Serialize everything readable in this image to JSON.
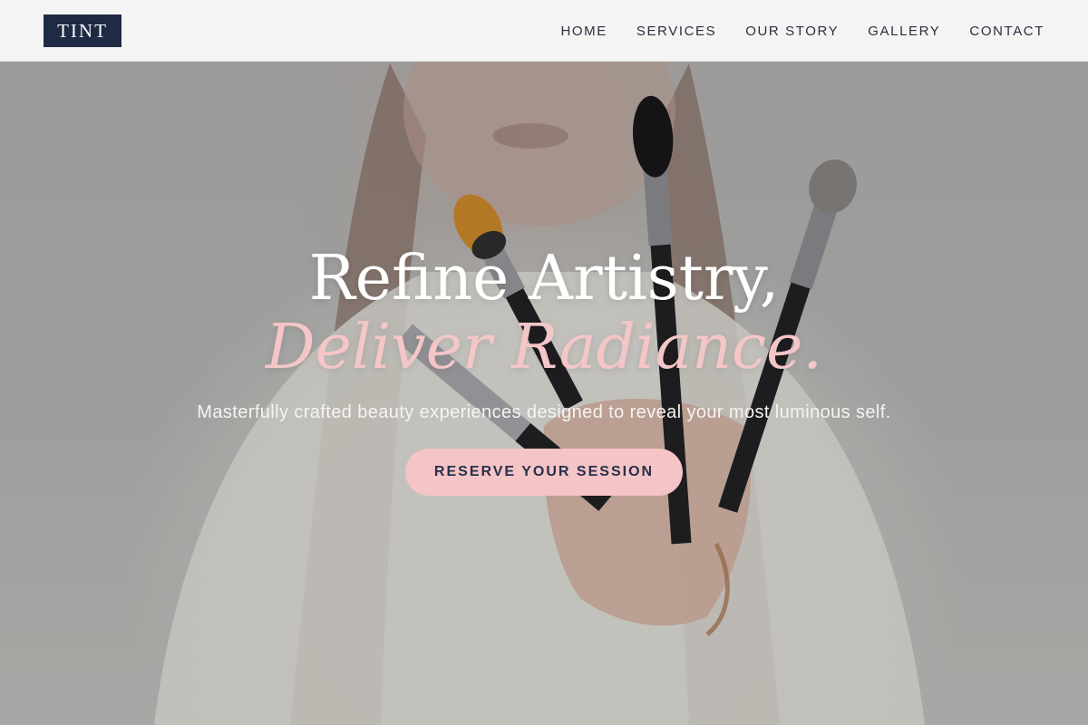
{
  "header": {
    "logo_text": "TINT",
    "nav": [
      {
        "label": "HOME"
      },
      {
        "label": "SERVICES"
      },
      {
        "label": "OUR STORY"
      },
      {
        "label": "GALLERY"
      },
      {
        "label": "CONTACT"
      }
    ]
  },
  "hero": {
    "title_line1": "Refine Artistry,",
    "title_line2": "Deliver Radiance.",
    "subtitle": "Masterfully crafted beauty experiences designed to reveal your most luminous self.",
    "cta_label": "RESERVE YOUR SESSION",
    "background_image": "woman-holding-makeup-brushes"
  },
  "colors": {
    "logo_background": "#1f2a44",
    "accent_pink": "#f5c4c6",
    "title_white": "#ffffff",
    "nav_text": "#2a2f3d",
    "button_text": "#27304a"
  }
}
